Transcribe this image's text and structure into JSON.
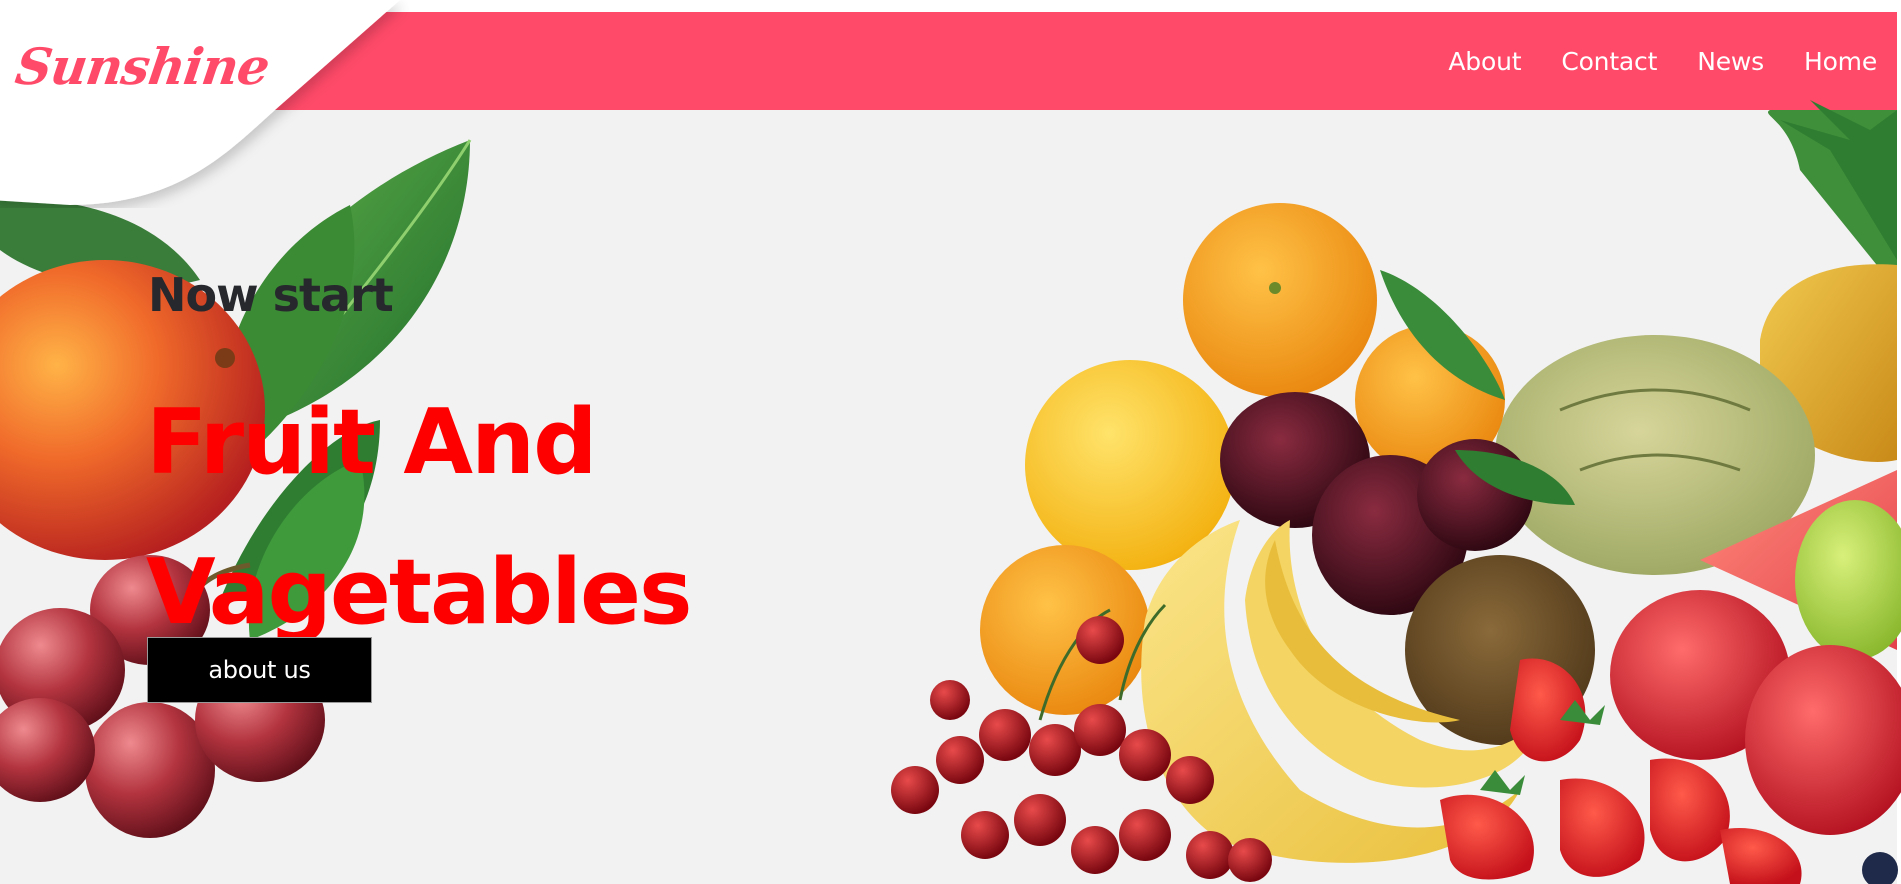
{
  "brand": {
    "logo_text": "Sunshine",
    "accent_color": "#ff4a69"
  },
  "nav": {
    "items": [
      {
        "label": "About"
      },
      {
        "label": "Contact"
      },
      {
        "label": "News"
      },
      {
        "label": "Home"
      }
    ]
  },
  "hero": {
    "pretitle": "Now start",
    "title_line1": "Fruit And",
    "title_line2": "Vagetables",
    "title_color": "#ff0000",
    "button_label": "about us",
    "background_color": "#f2f2f2"
  },
  "images": {
    "left": "fruit-left-image",
    "right": "fruit-right-image"
  }
}
